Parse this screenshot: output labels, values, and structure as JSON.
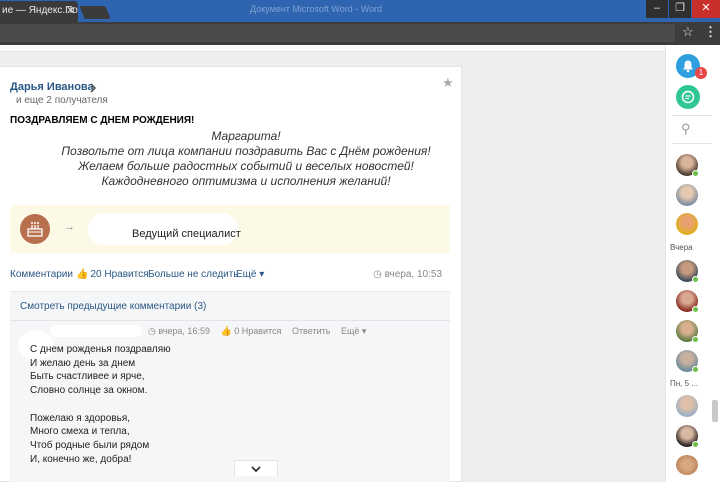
{
  "browser": {
    "tab_title": "ие — Яндекс.По",
    "tab_close": "✕",
    "window_title": "Документ Microsoft Word - Word",
    "controls": {
      "minimize": "–",
      "maximize": "❐",
      "close": "✕"
    },
    "star": "☆",
    "menu": "⋮"
  },
  "post": {
    "author": "Дарья Иванова",
    "recipients": "и еще 2 получателя",
    "headline": "ПОЗДРАВЛЯЕМ С ДНЕМ РОЖДЕНИЯ!",
    "greeting": [
      "Маргарита!",
      "Позвольте от лица компании поздравить Вас с Днём рождения!",
      "Желаем больше радостных событий и веселых новостей!",
      "Каждодневного оптимизма и исполнения желаний!"
    ],
    "award": {
      "arrow": "→",
      "title": "Ведущий специалист",
      "icon": "cake-icon"
    },
    "actions": {
      "comments": "Комментарии",
      "like_icon": "👍",
      "likes": "20 Нравится",
      "unfollow": "Больше не следить",
      "more": "Ещё ▾",
      "time": "◷ вчера, 10:53"
    },
    "prev_comments": "Смотреть предыдущие комментарии (3)",
    "comment": {
      "time": "◷ вчера, 16:59",
      "likes": "👍 0 Нравится",
      "reply": "Ответить",
      "more": "Ещё ▾",
      "lines": [
        "С днем рожденья поздравляю",
        "И желаю день за днем",
        "Быть счастливее и ярче,",
        "Словно солнце за окном.",
        "",
        "Пожелаю я здоровья,",
        "Много смеха и тепла,",
        "Чтоб родные были рядом",
        "И, конечно же, добра!"
      ]
    },
    "expand": "⌄"
  },
  "rail": {
    "notif_count": "1",
    "search_icon": "⚲",
    "label_yesterday": "Вчера",
    "label_date": "Пн, 5 ...",
    "colors": {
      "notif": "#2f9fe0",
      "chat": "#2fc792",
      "online": "#6cc04a",
      "badge": "#e64646"
    }
  }
}
